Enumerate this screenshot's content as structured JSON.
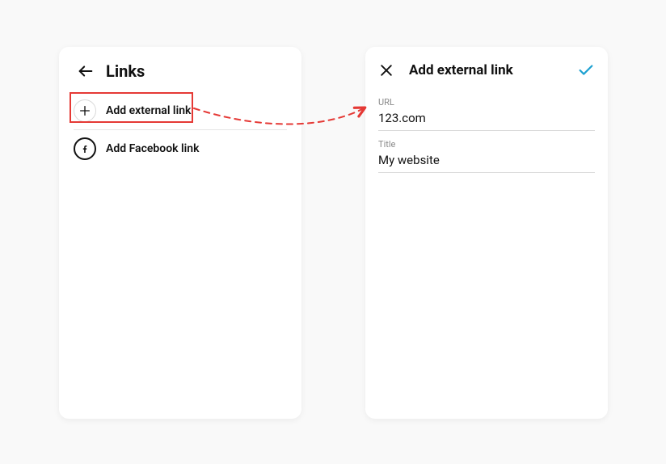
{
  "left_panel": {
    "title": "Links",
    "rows": [
      {
        "label": "Add external link"
      },
      {
        "label": "Add Facebook link"
      }
    ]
  },
  "right_panel": {
    "title": "Add external link",
    "fields": {
      "url": {
        "label": "URL",
        "value": "123.com"
      },
      "title": {
        "label": "Title",
        "value": "My website"
      }
    }
  }
}
